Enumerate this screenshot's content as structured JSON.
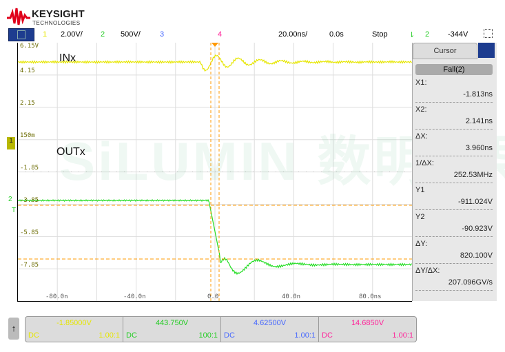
{
  "header": {
    "brand": "KEYSIGHT",
    "brand_sub": "TECHNOLOGIES"
  },
  "topbar": {
    "ch1": "1",
    "ch1_scale": "2.00V/",
    "ch2": "2",
    "ch2_scale": "500V/",
    "ch3": "3",
    "ch4": "4",
    "timebase": "20.00ns/",
    "delay": "0.0s",
    "run_state": "Stop",
    "trig_source": "2",
    "trig_level": "-344V"
  },
  "plot": {
    "y_labels": [
      "6.15V",
      "4.15",
      "2.15",
      "150m",
      "-1.85",
      "-3.85",
      "-5.85",
      "-7.85"
    ],
    "x_labels": [
      "-80.0n",
      "-40.0n",
      "0.0",
      "40.0n",
      "80.0ns"
    ],
    "annot_in": "INx",
    "annot_out": "OUTx",
    "watermark": "SiLUMIN 数明半导体",
    "ch1_marker": "1",
    "ch2_marker": "2",
    "trig_marker": "T"
  },
  "colors": {
    "ch1": "#e6e600",
    "ch2": "#22dd22",
    "ch3": "#4466ff",
    "ch4": "#ff2299",
    "cursor": "#ff9900"
  },
  "cursor_panel": {
    "title": "Cursor",
    "mode": "Fall(2)",
    "items": [
      {
        "label": "X1:",
        "value": "-1.813ns"
      },
      {
        "label": "X2:",
        "value": "2.141ns"
      },
      {
        "label": "ΔX:",
        "value": "3.960ns"
      },
      {
        "label": "1/ΔX:",
        "value": "252.53MHz"
      },
      {
        "label": "Y1",
        "value": "-911.024V"
      },
      {
        "label": "Y2",
        "value": "-90.923V"
      },
      {
        "label": "ΔY:",
        "value": "820.100V"
      },
      {
        "label": "ΔY/ΔX:",
        "value": "207.096GV/s"
      }
    ]
  },
  "channels": [
    {
      "value": "-1.85000V",
      "coupling": "DC",
      "probe": "1.00:1"
    },
    {
      "value": "443.750V",
      "coupling": "DC",
      "probe": "100:1"
    },
    {
      "value": "4.62500V",
      "coupling": "DC",
      "probe": "1.00:1"
    },
    {
      "value": "14.6850V",
      "coupling": "DC",
      "probe": "1.00:1"
    }
  ]
}
